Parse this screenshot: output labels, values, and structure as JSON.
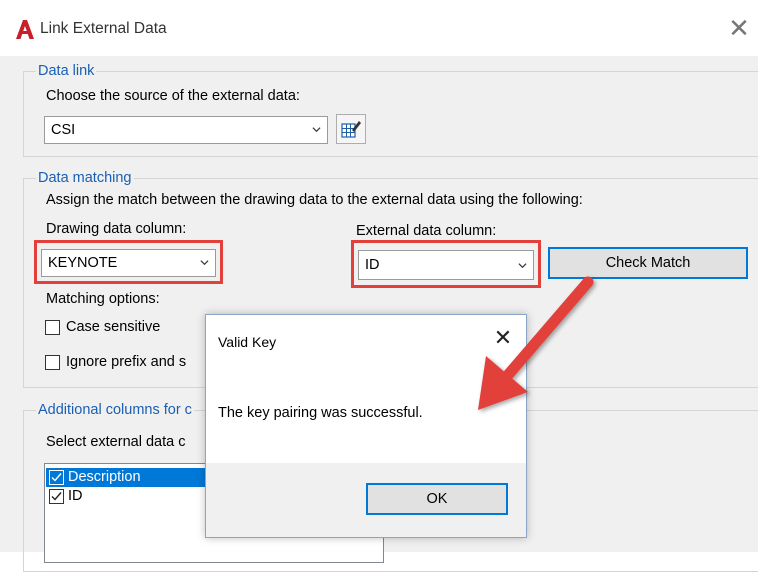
{
  "window": {
    "title": "Link External Data"
  },
  "data_link": {
    "legend": "Data link",
    "prompt": "Choose the source of the external data:",
    "source_value": "CSI"
  },
  "data_matching": {
    "legend": "Data matching",
    "instruction": "Assign the match between the drawing data to the external data using the following:",
    "drawing_label": "Drawing data column:",
    "drawing_value": "KEYNOTE",
    "external_label": "External data column:",
    "external_value": "ID",
    "check_match": "Check Match",
    "options_label": "Matching options:",
    "case_sensitive": "Case sensitive",
    "ignore_prefix": "Ignore prefix and s"
  },
  "additional": {
    "legend": "Additional columns for c",
    "prompt": "Select external data c",
    "items": [
      {
        "label": "Description",
        "checked": true,
        "selected": true
      },
      {
        "label": "ID",
        "checked": true,
        "selected": false
      }
    ]
  },
  "popup": {
    "title": "Valid Key",
    "message": "The key pairing was successful.",
    "ok": "OK"
  },
  "colors": {
    "accent": "#0078d7",
    "highlight": "#e2403b",
    "selection": "#0078d7",
    "legend": "#1a5fb4"
  }
}
